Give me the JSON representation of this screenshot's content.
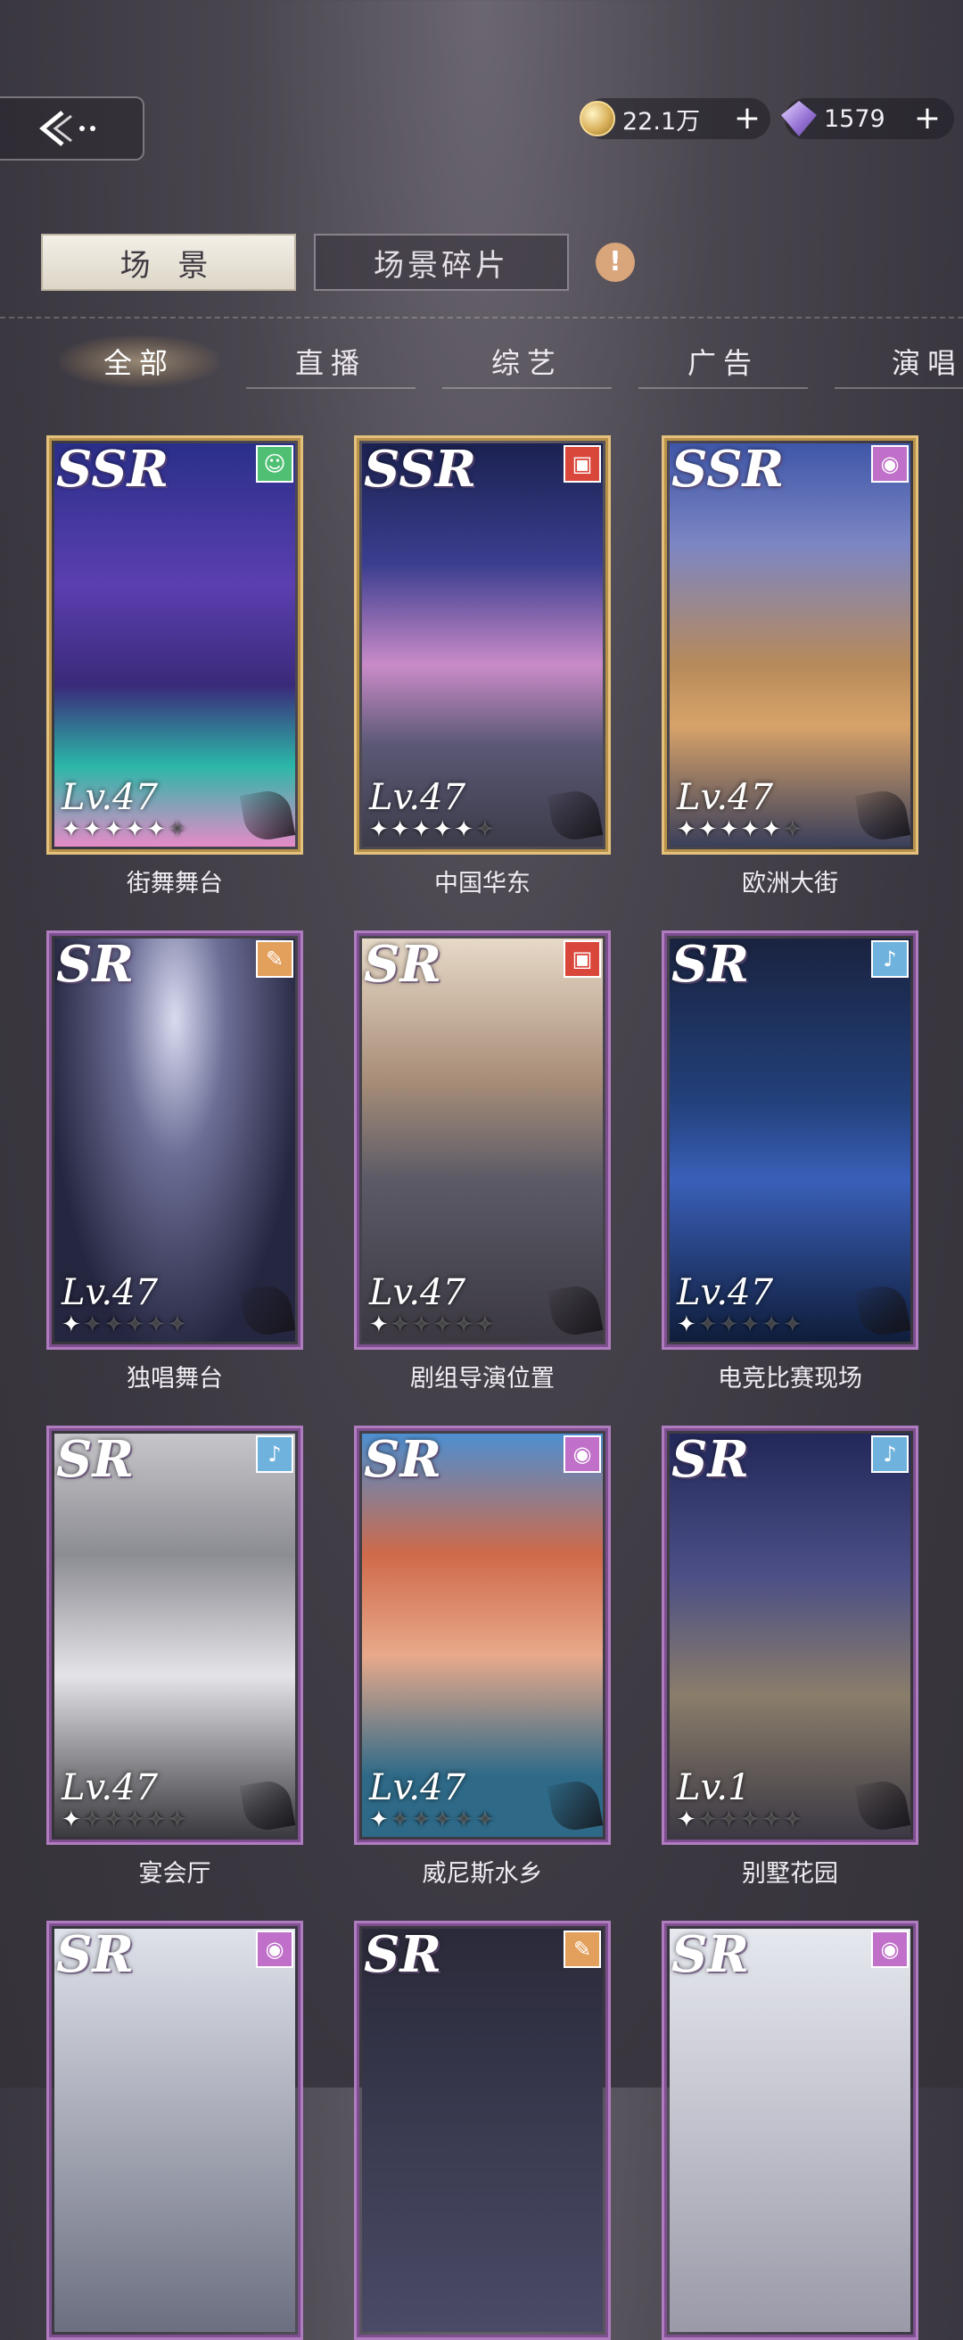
{
  "header": {
    "currencies": [
      {
        "icon": "coin-icon",
        "value": "22.1万",
        "plus": "+"
      },
      {
        "icon": "gem-icon",
        "value": "1579",
        "plus": "+"
      }
    ]
  },
  "tabs": {
    "main": [
      {
        "label": "场 景",
        "active": true
      },
      {
        "label": "场景碎片",
        "active": false
      }
    ],
    "info": "!",
    "filters": [
      {
        "label": "全部",
        "active": true
      },
      {
        "label": "直播",
        "active": false
      },
      {
        "label": "综艺",
        "active": false
      },
      {
        "label": "广告",
        "active": false
      },
      {
        "label": "演唱",
        "active": false
      }
    ]
  },
  "cards": [
    {
      "name": "街舞舞台",
      "rarity": "SSR",
      "level": "Lv.47",
      "stars": 5,
      "badge": "smile-icon",
      "badge_color": "#4fbf73"
    },
    {
      "name": "中国华东",
      "rarity": "SSR",
      "level": "Lv.47",
      "stars": 5,
      "badge": "clapper-icon",
      "badge_color": "#d9473b"
    },
    {
      "name": "欧洲大街",
      "rarity": "SSR",
      "level": "Lv.47",
      "stars": 5,
      "badge": "lens-icon",
      "badge_color": "#c070c9"
    },
    {
      "name": "独唱舞台",
      "rarity": "SR",
      "level": "Lv.47",
      "stars": 1,
      "badge": "mic-icon",
      "badge_color": "#e3a05d"
    },
    {
      "name": "剧组导演位置",
      "rarity": "SR",
      "level": "Lv.47",
      "stars": 1,
      "badge": "clapper-icon",
      "badge_color": "#d9473b"
    },
    {
      "name": "电竞比赛现场",
      "rarity": "SR",
      "level": "Lv.47",
      "stars": 1,
      "badge": "mic2-icon",
      "badge_color": "#6fb2de"
    },
    {
      "name": "宴会厅",
      "rarity": "SR",
      "level": "Lv.47",
      "stars": 1,
      "badge": "mic2-icon",
      "badge_color": "#6fb2de"
    },
    {
      "name": "威尼斯水乡",
      "rarity": "SR",
      "level": "Lv.47",
      "stars": 1,
      "badge": "lens-icon",
      "badge_color": "#c070c9"
    },
    {
      "name": "别墅花园",
      "rarity": "SR",
      "level": "Lv.1",
      "stars": 1,
      "badge": "mic2-icon",
      "badge_color": "#6fb2de"
    },
    {
      "name": "",
      "rarity": "SR",
      "level": "",
      "stars": 0,
      "badge": "lens-icon",
      "badge_color": "#c070c9"
    },
    {
      "name": "",
      "rarity": "SR",
      "level": "",
      "stars": 0,
      "badge": "mic-icon",
      "badge_color": "#e3a05d"
    },
    {
      "name": "",
      "rarity": "SR",
      "level": "",
      "stars": 0,
      "badge": "lens-icon",
      "badge_color": "#c070c9"
    }
  ]
}
